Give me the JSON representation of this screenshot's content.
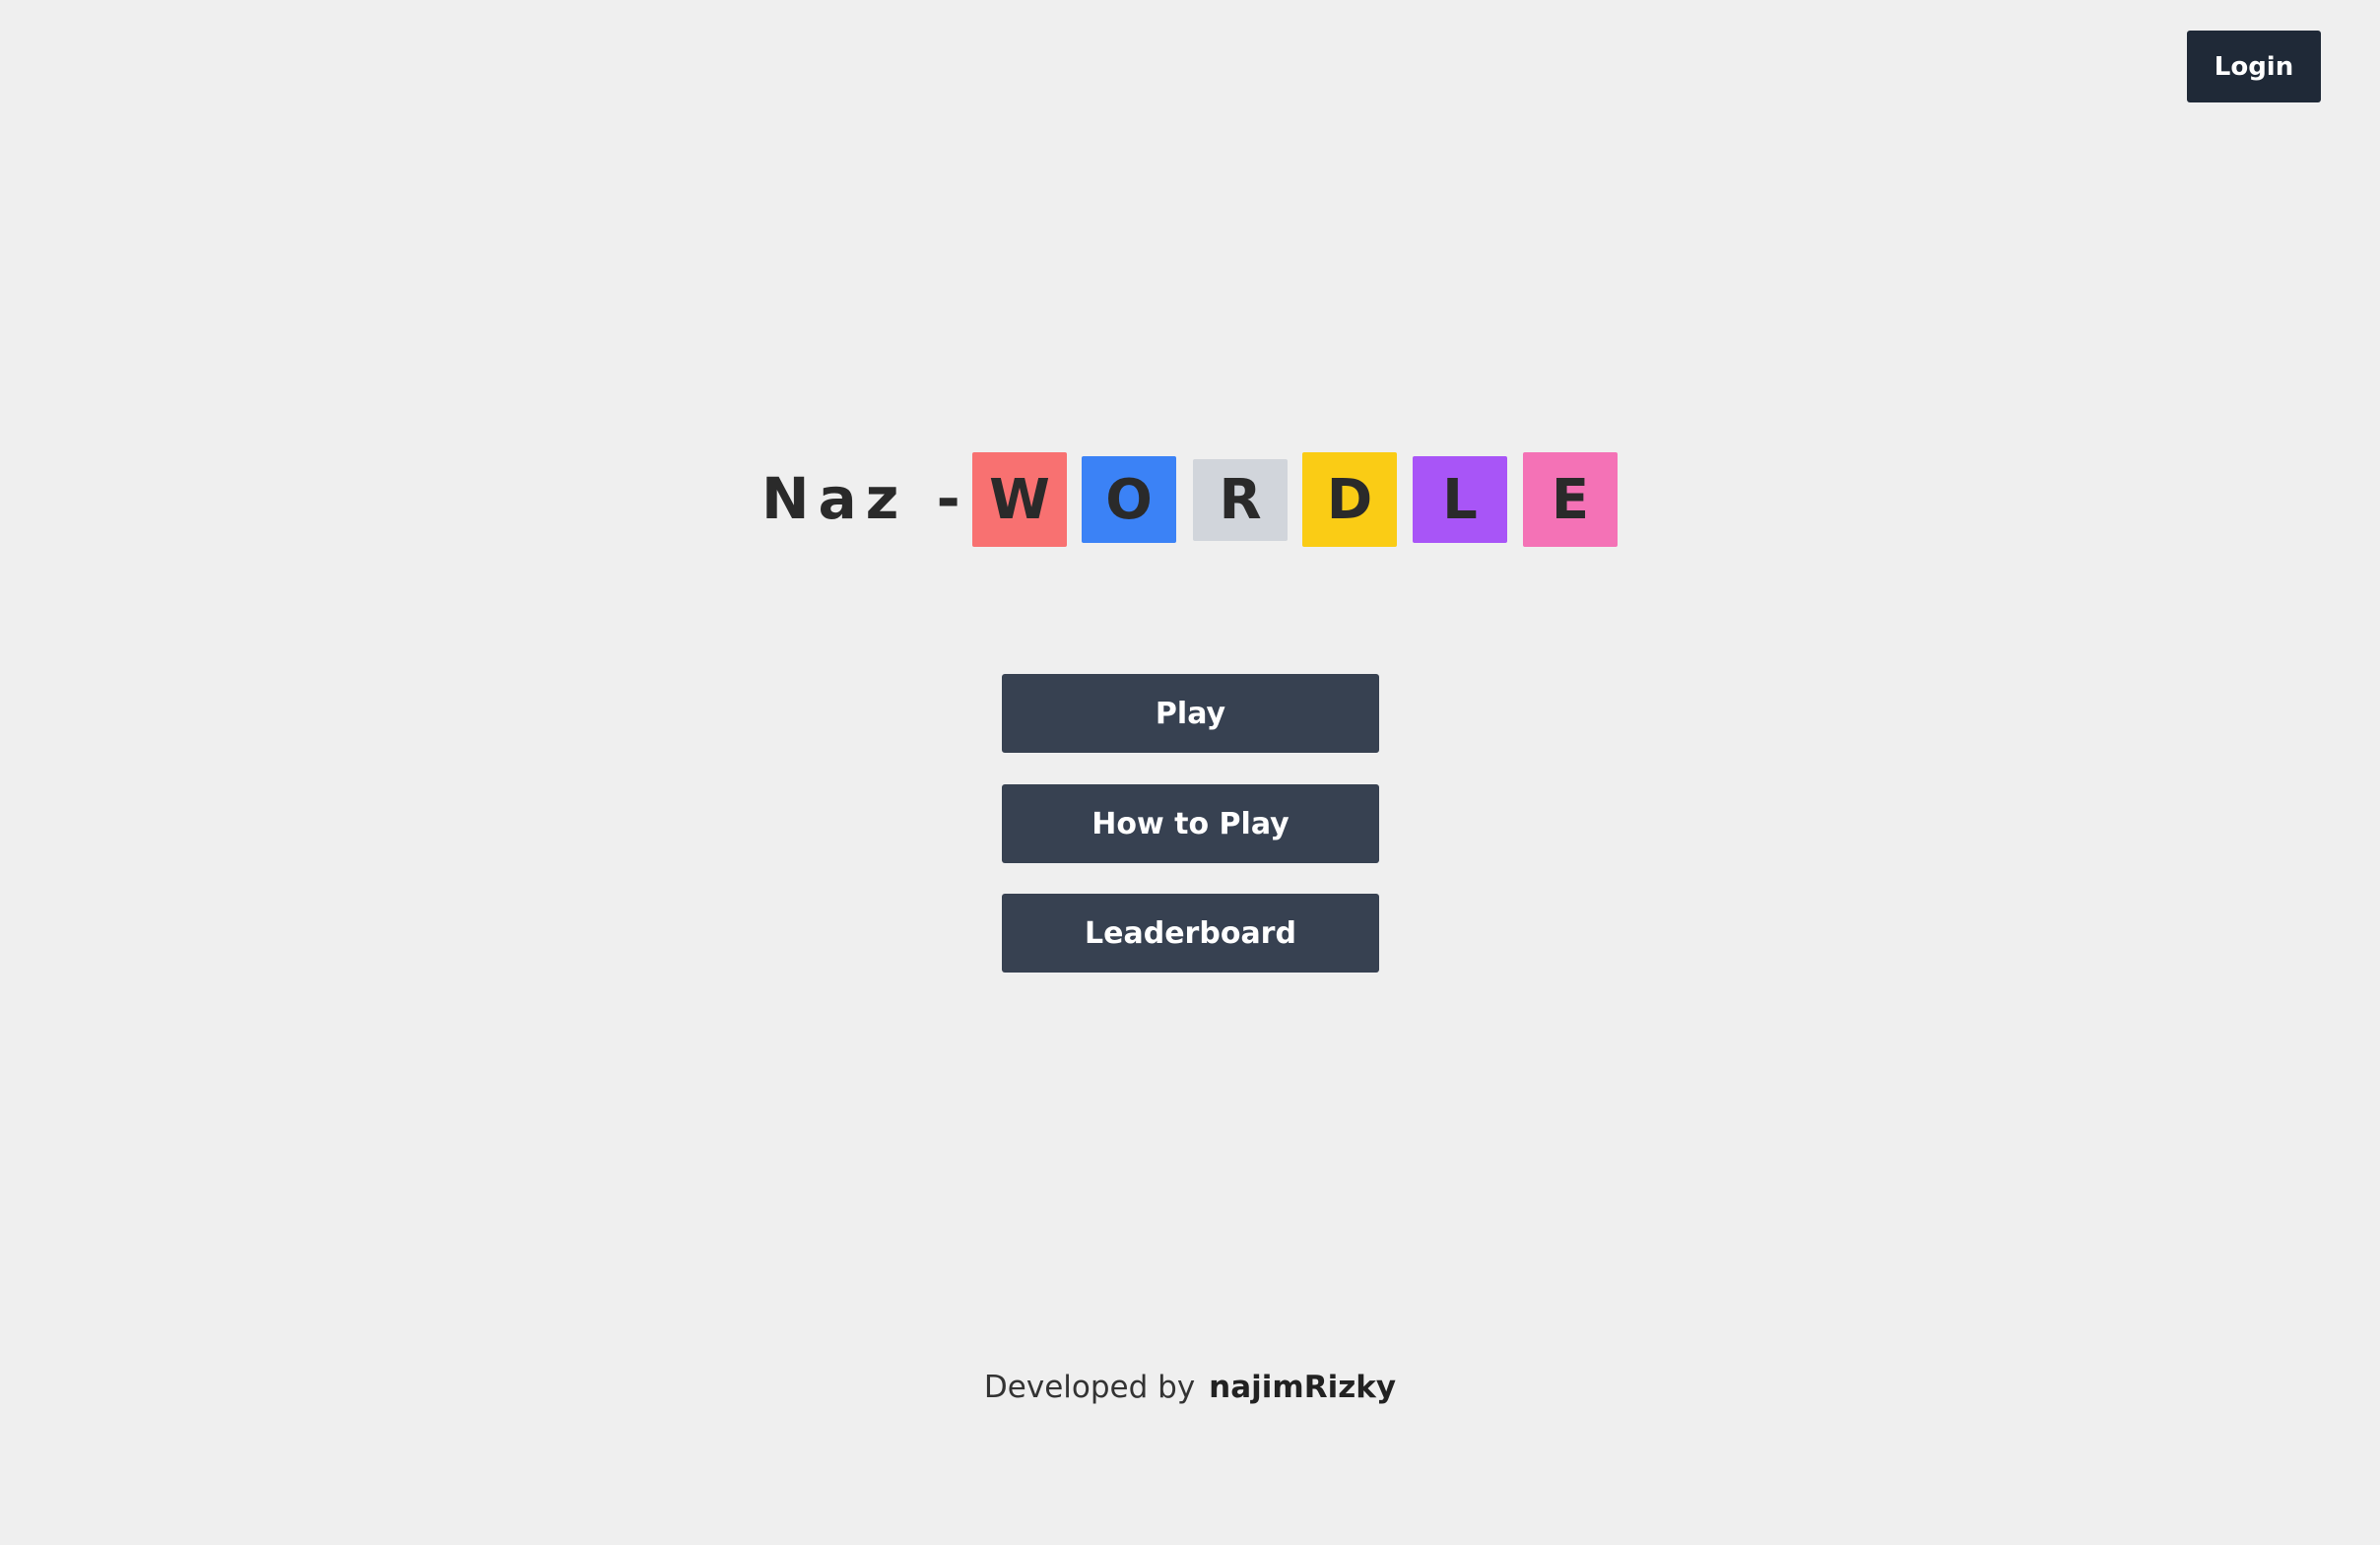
{
  "header": {
    "login_label": "Login"
  },
  "title": {
    "prefix": "Naz -",
    "tiles": [
      {
        "letter": "W",
        "color": "#f87171"
      },
      {
        "letter": "O",
        "color": "#3b82f6"
      },
      {
        "letter": "R",
        "color": "#d1d5db"
      },
      {
        "letter": "D",
        "color": "#facc15"
      },
      {
        "letter": "L",
        "color": "#a855f7"
      },
      {
        "letter": "E",
        "color": "#f472b6"
      }
    ]
  },
  "menu": {
    "play_label": "Play",
    "how_to_play_label": "How to Play",
    "leaderboard_label": "Leaderboard"
  },
  "footer": {
    "developed_by": "Developed by",
    "author": "najimRizky"
  },
  "colors": {
    "background": "#efefef",
    "button": "#374151",
    "login_button": "#1f2937"
  }
}
